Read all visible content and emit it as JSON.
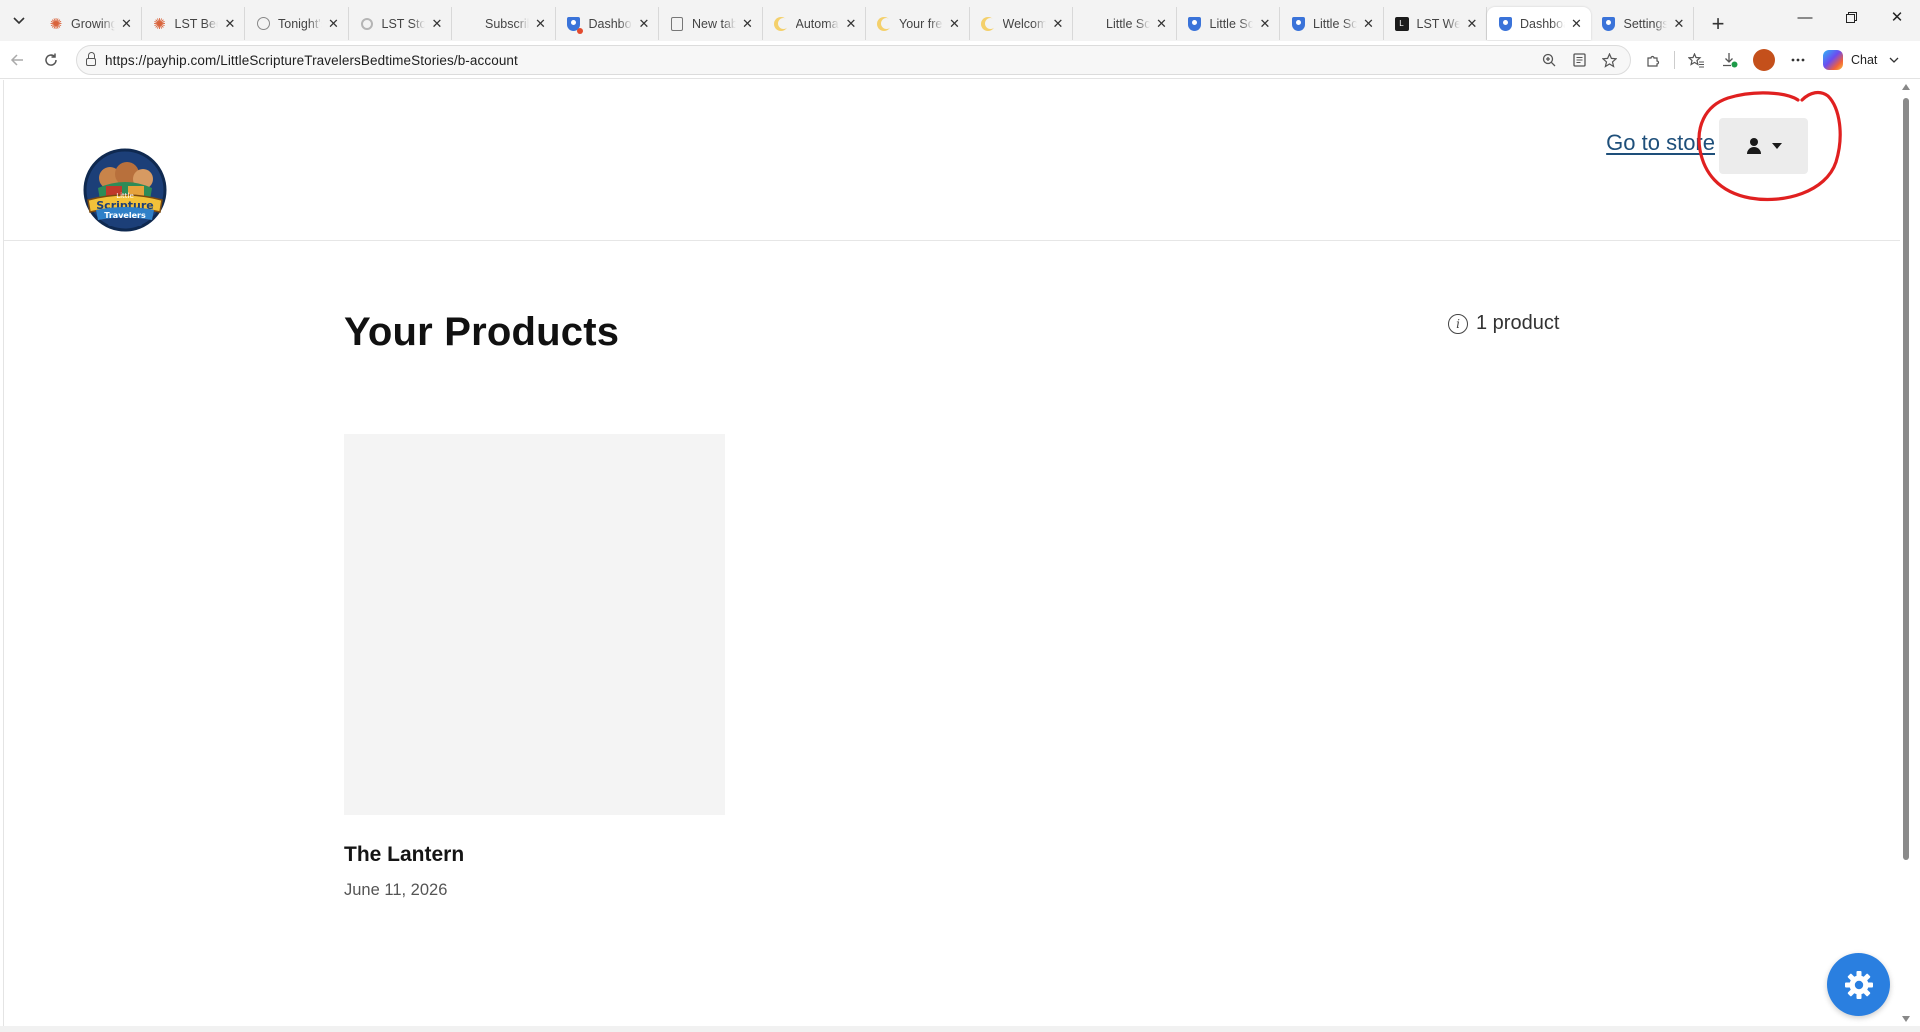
{
  "browser": {
    "tabs": [
      {
        "title": "Growing",
        "favicon": "claude-icon",
        "active": false
      },
      {
        "title": "LST Bedt",
        "favicon": "claude-icon",
        "active": false
      },
      {
        "title": "Tonight's",
        "favicon": "globe-icon",
        "active": false
      },
      {
        "title": "LST Story",
        "favicon": "loading-icon",
        "active": false
      },
      {
        "title": "Subscrib",
        "favicon": "none",
        "active": false
      },
      {
        "title": "Dashboa",
        "favicon": "payhip-icon",
        "active": false
      },
      {
        "title": "New tab",
        "favicon": "page-icon",
        "active": false
      },
      {
        "title": "Automat",
        "favicon": "moon-icon",
        "active": false
      },
      {
        "title": "Your free",
        "favicon": "moon-icon",
        "active": false
      },
      {
        "title": "Welcom",
        "favicon": "moon-icon",
        "active": false
      },
      {
        "title": "Little Scr",
        "favicon": "none",
        "active": false
      },
      {
        "title": "Little Scr",
        "favicon": "payhip-icon",
        "active": false
      },
      {
        "title": "Little Scr",
        "favicon": "payhip-icon",
        "active": false
      },
      {
        "title": "LST Web",
        "favicon": "lst-icon",
        "active": false
      },
      {
        "title": "Dashboa",
        "favicon": "payhip-icon",
        "active": true
      },
      {
        "title": "Settings",
        "favicon": "payhip-icon",
        "active": false
      }
    ],
    "url": "https://payhip.com/LittleScriptureTravelersBedtimeStories/b-account",
    "chat_label": "Chat"
  },
  "header": {
    "logo_alt": "Little Scripture Travelers",
    "logo_line1": "Little",
    "logo_line2": "Scripture",
    "logo_line3": "Travelers",
    "go_to_store": "Go to store"
  },
  "main": {
    "title": "Your Products",
    "product_count": "1 product",
    "products": [
      {
        "name": "The Lantern",
        "date": "June 11, 2026"
      }
    ]
  },
  "colors": {
    "link": "#1e4f7a",
    "fab": "#2a7fe0",
    "annotation": "#e02020"
  }
}
